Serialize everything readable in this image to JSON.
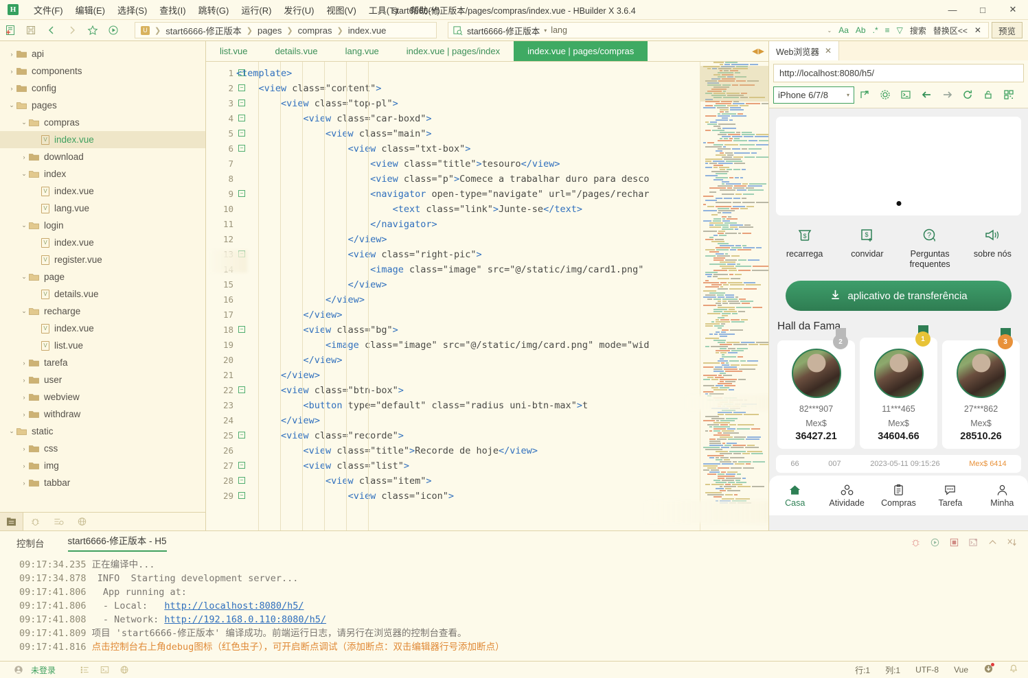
{
  "window": {
    "title": "start6666-修正版本/pages/compras/index.vue - HBuilder X 3.6.4",
    "logo": "H",
    "minimize": "—",
    "maximize": "□",
    "close": "✕"
  },
  "menubar": {
    "items": [
      "文件(F)",
      "编辑(E)",
      "选择(S)",
      "查找(I)",
      "跳转(G)",
      "运行(R)",
      "发行(U)",
      "视图(V)",
      "工具(T)",
      "帮助(Y)"
    ]
  },
  "toolbar": {
    "breadcrumb": [
      "start6666-修正版本",
      "pages",
      "compras",
      "index.vue"
    ],
    "search_project": "start6666-修正版本",
    "search_value": "lang",
    "tools": [
      "Aa",
      "Ab",
      ".*",
      "≡",
      "▽"
    ],
    "search_label": "搜索",
    "replace_label": "替换区<<",
    "close_label": "✕",
    "preview_label": "预览"
  },
  "sidebar": {
    "items": [
      {
        "label": "api",
        "type": "folder",
        "state": "collapsed",
        "depth": 1
      },
      {
        "label": "components",
        "type": "folder",
        "state": "collapsed",
        "depth": 1
      },
      {
        "label": "config",
        "type": "folder",
        "state": "collapsed",
        "depth": 1
      },
      {
        "label": "pages",
        "type": "folder",
        "state": "expanded",
        "depth": 1
      },
      {
        "label": "compras",
        "type": "folder",
        "state": "expanded",
        "depth": 2
      },
      {
        "label": "index.vue",
        "type": "vue",
        "state": "selected",
        "depth": 3
      },
      {
        "label": "download",
        "type": "folder",
        "state": "collapsed",
        "depth": 2
      },
      {
        "label": "index",
        "type": "folder",
        "state": "expanded",
        "depth": 2
      },
      {
        "label": "index.vue",
        "type": "vue",
        "state": "none",
        "depth": 3
      },
      {
        "label": "lang.vue",
        "type": "vue",
        "state": "none",
        "depth": 3
      },
      {
        "label": "login",
        "type": "folder",
        "state": "expanded",
        "depth": 2
      },
      {
        "label": "index.vue",
        "type": "vue",
        "state": "none",
        "depth": 3
      },
      {
        "label": "register.vue",
        "type": "vue",
        "state": "none",
        "depth": 3
      },
      {
        "label": "page",
        "type": "folder",
        "state": "expanded",
        "depth": 2
      },
      {
        "label": "details.vue",
        "type": "vue",
        "state": "none",
        "depth": 3
      },
      {
        "label": "recharge",
        "type": "folder",
        "state": "expanded",
        "depth": 2
      },
      {
        "label": "index.vue",
        "type": "vue",
        "state": "none",
        "depth": 3
      },
      {
        "label": "list.vue",
        "type": "vue",
        "state": "none",
        "depth": 3
      },
      {
        "label": "tarefa",
        "type": "folder",
        "state": "collapsed",
        "depth": 2
      },
      {
        "label": "user",
        "type": "folder",
        "state": "collapsed",
        "depth": 2
      },
      {
        "label": "webview",
        "type": "folder",
        "state": "collapsed",
        "depth": 2
      },
      {
        "label": "withdraw",
        "type": "folder",
        "state": "collapsed",
        "depth": 2
      },
      {
        "label": "static",
        "type": "folder",
        "state": "expanded",
        "depth": 1
      },
      {
        "label": "css",
        "type": "folder",
        "state": "collapsed",
        "depth": 2
      },
      {
        "label": "img",
        "type": "folder",
        "state": "collapsed",
        "depth": 2
      },
      {
        "label": "tabbar",
        "type": "folder",
        "state": "collapsed",
        "depth": 2
      }
    ],
    "bottom_tabs": [
      "project-icon",
      "bug-icon",
      "outline-icon",
      "globe-icon"
    ]
  },
  "editor": {
    "tabs": [
      {
        "label": "list.vue",
        "active": false
      },
      {
        "label": "details.vue",
        "active": false
      },
      {
        "label": "lang.vue",
        "active": false
      },
      {
        "label": "index.vue | pages/index",
        "active": false
      },
      {
        "label": "index.vue | pages/compras",
        "active": true
      }
    ],
    "lines": [
      {
        "n": 1,
        "fold": true,
        "text": "<template>"
      },
      {
        "n": 2,
        "fold": true,
        "text": "    <view class=\"content\">"
      },
      {
        "n": 3,
        "fold": true,
        "text": "        <view class=\"top-pl\">"
      },
      {
        "n": 4,
        "fold": true,
        "text": "            <view class=\"car-boxd\">"
      },
      {
        "n": 5,
        "fold": true,
        "text": "                <view class=\"main\">"
      },
      {
        "n": 6,
        "fold": true,
        "text": "                    <view class=\"txt-box\">"
      },
      {
        "n": 7,
        "fold": false,
        "text": "                        <view class=\"title\">tesouro</view>"
      },
      {
        "n": 8,
        "fold": false,
        "text": "                        <view class=\"p\">Comece a trabalhar duro para desco"
      },
      {
        "n": 9,
        "fold": true,
        "text": "                        <navigator open-type=\"navigate\" url=\"/pages/rechar"
      },
      {
        "n": 10,
        "fold": false,
        "text": "                            <text class=\"link\">Junte-se</text>"
      },
      {
        "n": 11,
        "fold": false,
        "text": "                        </navigator>"
      },
      {
        "n": 12,
        "fold": false,
        "text": "                    </view>"
      },
      {
        "n": 13,
        "fold": true,
        "text": "                    <view class=\"right-pic\">"
      },
      {
        "n": 14,
        "fold": false,
        "text": "                        <image class=\"image\" src=\"@/static/img/card1.png\""
      },
      {
        "n": 15,
        "fold": false,
        "text": "                    </view>"
      },
      {
        "n": 16,
        "fold": false,
        "text": "                </view>"
      },
      {
        "n": 17,
        "fold": false,
        "text": "            </view>"
      },
      {
        "n": 18,
        "fold": true,
        "text": "            <view class=\"bg\">"
      },
      {
        "n": 19,
        "fold": false,
        "text": "                <image class=\"image\" src=\"@/static/img/card.png\" mode=\"wid"
      },
      {
        "n": 20,
        "fold": false,
        "text": "            </view>"
      },
      {
        "n": 21,
        "fold": false,
        "text": "        </view>"
      },
      {
        "n": 22,
        "fold": true,
        "text": "        <view class=\"btn-box\">"
      },
      {
        "n": 23,
        "fold": false,
        "text": "            <button type=\"default\" class=\"radius uni-btn-max\">t"
      },
      {
        "n": 24,
        "fold": false,
        "text": "        </view>"
      },
      {
        "n": 25,
        "fold": true,
        "text": "        <view class=\"recorde\">"
      },
      {
        "n": 26,
        "fold": false,
        "text": "            <view class=\"title\">Recorde de hoje</view>"
      },
      {
        "n": 27,
        "fold": true,
        "text": "            <view class=\"list\">"
      },
      {
        "n": 28,
        "fold": true,
        "text": "                <view class=\"item\">"
      },
      {
        "n": 29,
        "fold": true,
        "text": "                    <view class=\"icon\">"
      }
    ]
  },
  "preview": {
    "tab_label": "Web浏览器",
    "tab_close": "✕",
    "url": "http://localhost:8080/h5/",
    "device": "iPhone 6/7/8",
    "device_caret": "▾",
    "icons": [
      "resize-icon",
      "gear-icon",
      "terminal-icon",
      "back-arrow-icon",
      "forward-arrow-icon",
      "reload-icon",
      "lock-icon",
      "qr-icon"
    ],
    "quick_actions": [
      {
        "label": "recarrega",
        "icon": "deposit-icon"
      },
      {
        "label": "convidar",
        "icon": "invite-icon"
      },
      {
        "label": "Perguntas frequentes",
        "icon": "question-icon"
      },
      {
        "label": "sobre nós",
        "icon": "megaphone-icon"
      }
    ],
    "download_button": "aplicativo de transferência",
    "hall_title": "Hall da Fama",
    "cards": [
      {
        "rank": "2",
        "name": "82***907",
        "currency": "Mex$",
        "amount": "36427.21",
        "medal_color": "#b9b9b9"
      },
      {
        "rank": "1",
        "name": "11***465",
        "currency": "Mex$",
        "amount": "34604.66",
        "medal_color": "#e8c337"
      },
      {
        "rank": "3",
        "name": "27***862",
        "currency": "Mex$",
        "amount": "28510.26",
        "medal_color": "#e8913a"
      }
    ],
    "list_row": {
      "col1": "66",
      "col2": "007",
      "col3": "2023-05-11 09:15:26",
      "col4": "Mex$ 6414"
    },
    "tabbar": [
      {
        "label": "Casa",
        "icon": "home-icon",
        "active": true
      },
      {
        "label": "Atividade",
        "icon": "activity-icon",
        "active": false
      },
      {
        "label": "Compras",
        "icon": "clipboard-icon",
        "active": false
      },
      {
        "label": "Tarefa",
        "icon": "chat-icon",
        "active": false
      },
      {
        "label": "Minha",
        "icon": "person-icon",
        "active": false
      }
    ]
  },
  "console": {
    "title": "控制台",
    "tab": "start6666-修正版本 - H5",
    "actions": [
      "debug-bug-icon",
      "rerun-icon",
      "stop-icon",
      "new-terminal-icon",
      "collapse-icon",
      "clear-icon"
    ],
    "lines": [
      {
        "ts": "09:17:34.235",
        "text": " 正在编译中...",
        "style": "gray"
      },
      {
        "ts": "09:17:34.878",
        "text": "  INFO  Starting development server...",
        "style": "gray"
      },
      {
        "ts": "09:17:41.806",
        "text": "   App running at:",
        "style": "gray"
      },
      {
        "ts": "09:17:41.806",
        "text": "   - Local:   ",
        "link": "http://localhost:8080/h5/",
        "style": "gray"
      },
      {
        "ts": "09:17:41.808",
        "text": "   - Network: ",
        "link": "http://192.168.0.110:8080/h5/",
        "style": "gray"
      },
      {
        "ts": "09:17:41.809",
        "text": " 项目 'start6666-修正版本' 编译成功。前端运行日志，请另行在浏览器的控制台查看。",
        "style": "gray"
      },
      {
        "ts": "09:17:41.816",
        "text": " 点击控制台右上角debug图标（红色虫子），可开启断点调试（添加断点：双击编辑器行号添加断点）",
        "style": "orange"
      }
    ]
  },
  "statusbar": {
    "user": "未登录",
    "icons": [
      "list-icon",
      "terminal-icon",
      "globe-icon"
    ],
    "line": "行:1",
    "column": "列:1",
    "encoding": "UTF-8",
    "language": "Vue",
    "update_icon": "update-icon",
    "bell_icon": "bell-icon"
  },
  "colors": {
    "accent_green": "#3fa05f",
    "bg": "#fdfaea",
    "tab_active": "#3faa63",
    "orange": "#e08a37"
  }
}
